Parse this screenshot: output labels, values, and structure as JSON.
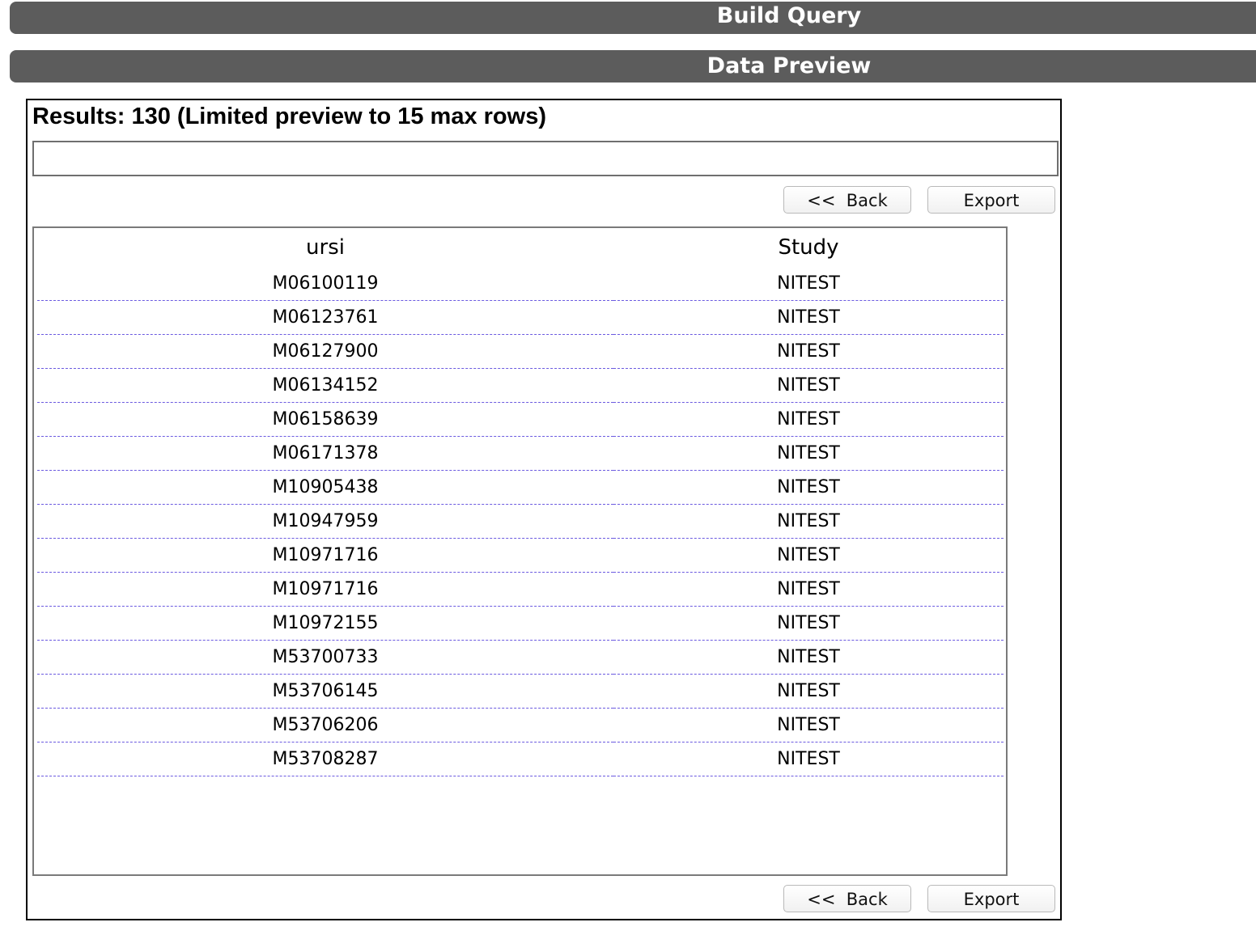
{
  "header": {
    "build_query_label": "Build Query",
    "data_preview_label": "Data Preview"
  },
  "preview": {
    "results_text": "Results: 130 (Limited preview to 15 max rows)",
    "message_box_value": "",
    "back_label": "<<  Back",
    "export_label": "Export"
  },
  "table": {
    "columns": [
      "ursi",
      "Study"
    ],
    "rows": [
      [
        "M06100119",
        "NITEST"
      ],
      [
        "M06123761",
        "NITEST"
      ],
      [
        "M06127900",
        "NITEST"
      ],
      [
        "M06134152",
        "NITEST"
      ],
      [
        "M06158639",
        "NITEST"
      ],
      [
        "M06171378",
        "NITEST"
      ],
      [
        "M10905438",
        "NITEST"
      ],
      [
        "M10947959",
        "NITEST"
      ],
      [
        "M10971716",
        "NITEST"
      ],
      [
        "M10971716",
        "NITEST"
      ],
      [
        "M10972155",
        "NITEST"
      ],
      [
        "M53700733",
        "NITEST"
      ],
      [
        "M53706145",
        "NITEST"
      ],
      [
        "M53706206",
        "NITEST"
      ],
      [
        "M53708287",
        "NITEST"
      ]
    ]
  },
  "colors": {
    "section_bar": "#5c5c5c",
    "row_divider": "#6b5ae0"
  }
}
